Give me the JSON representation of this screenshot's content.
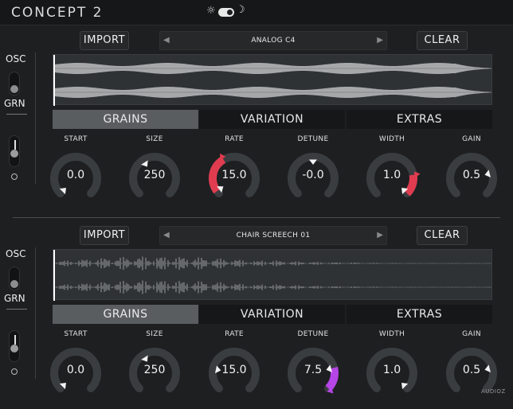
{
  "app": {
    "title": "CONCEPT 2"
  },
  "theme": {
    "sun": "☼",
    "moon": "☽"
  },
  "panels": [
    {
      "import_label": "IMPORT",
      "clear_label": "CLEAR",
      "sample_name": "ANALOG C4",
      "prev_arrow": "◀",
      "next_arrow": "▶",
      "osc_label": "OSC",
      "grn_label": "GRN",
      "tabs": [
        "GRAINS",
        "VARIATION",
        "EXTRAS"
      ],
      "active_tab": "GRAINS",
      "accent": "#e03c4f",
      "knobs": [
        {
          "label": "START",
          "value": "0.0",
          "level": 0.0,
          "mod": 0
        },
        {
          "label": "SIZE",
          "value": "250",
          "level": 0.38,
          "mod": 0
        },
        {
          "label": "RATE",
          "value": "15.0",
          "level": 0.03,
          "mod": 0.36
        },
        {
          "label": "DETUNE",
          "value": "-0.0",
          "level": 0.5,
          "mod": 0
        },
        {
          "label": "WIDTH",
          "value": "1.0",
          "level": 1.0,
          "mod": -0.2
        },
        {
          "label": "GAIN",
          "value": "0.5",
          "level": 0.78,
          "mod": 0
        }
      ]
    },
    {
      "import_label": "IMPORT",
      "clear_label": "CLEAR",
      "sample_name": "CHAIR SCREECH 01",
      "prev_arrow": "◀",
      "next_arrow": "▶",
      "osc_label": "OSC",
      "grn_label": "GRN",
      "tabs": [
        "GRAINS",
        "VARIATION",
        "EXTRAS"
      ],
      "active_tab": "GRAINS",
      "accent": "#b545e6",
      "knobs": [
        {
          "label": "START",
          "value": "0.0",
          "level": 0.0,
          "mod": 0
        },
        {
          "label": "SIZE",
          "value": "250",
          "level": 0.38,
          "mod": 0
        },
        {
          "label": "RATE",
          "value": "15.0",
          "level": 0.21,
          "mod": 0
        },
        {
          "label": "DETUNE",
          "value": "7.5",
          "level": 0.78,
          "mod": 0.22
        },
        {
          "label": "WIDTH",
          "value": "1.0",
          "level": 1.0,
          "mod": 0
        },
        {
          "label": "GAIN",
          "value": "0.5",
          "level": 0.78,
          "mod": 0
        }
      ]
    }
  ],
  "watermark": "AUDIOZ"
}
